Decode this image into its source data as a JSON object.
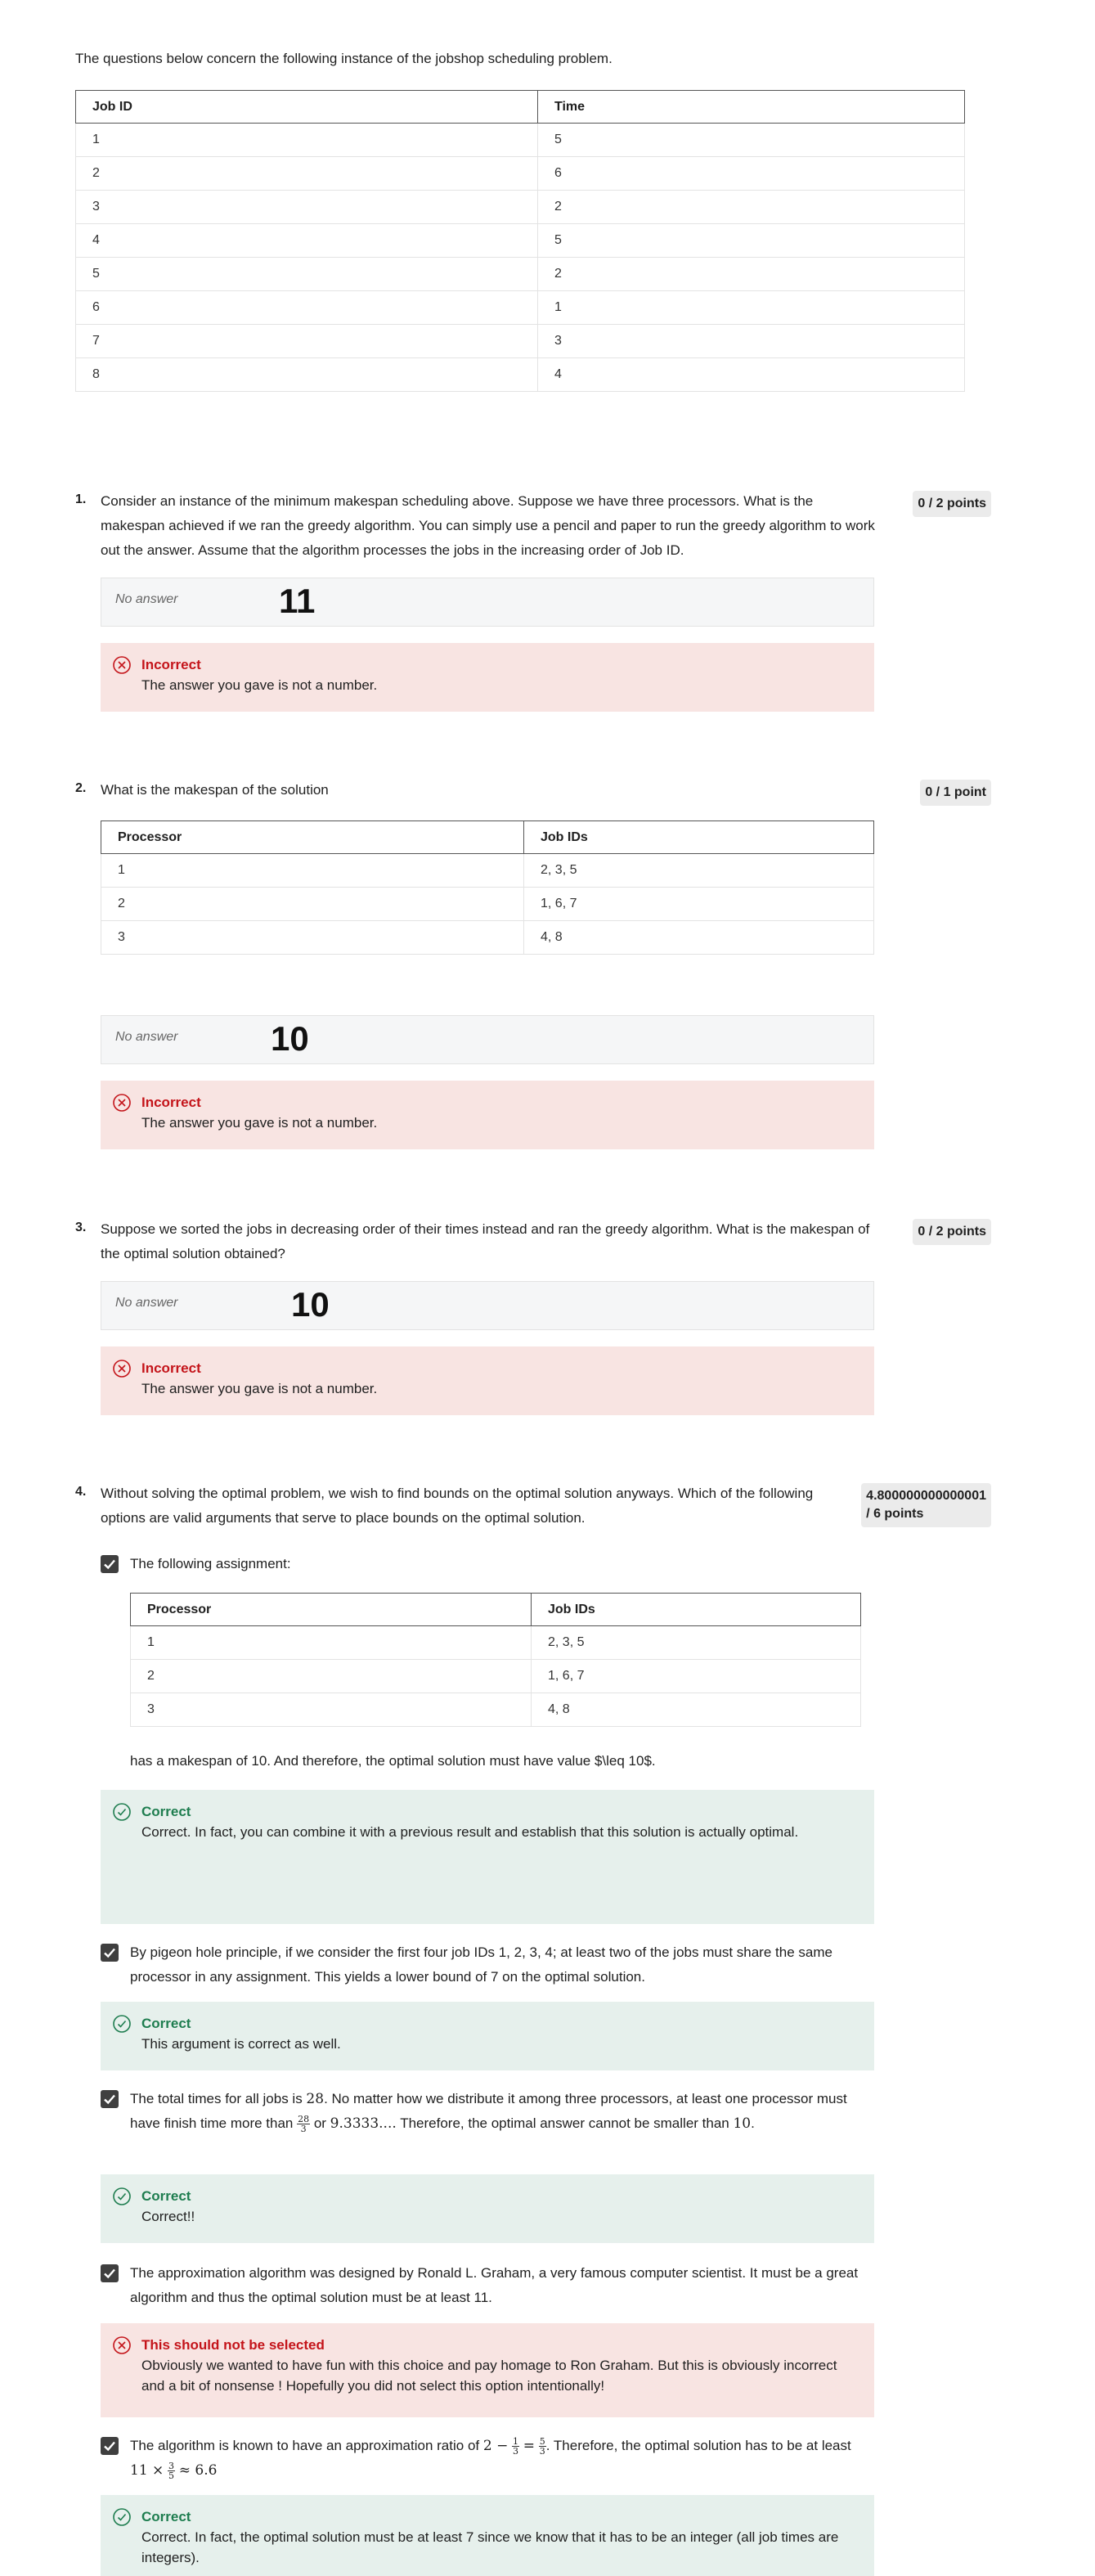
{
  "intro": "The questions below concern the following instance of the jobshop scheduling problem.",
  "jobs_table": {
    "headers": [
      "Job ID",
      "Time"
    ],
    "rows": [
      [
        "1",
        "5"
      ],
      [
        "2",
        "6"
      ],
      [
        "3",
        "2"
      ],
      [
        "4",
        "5"
      ],
      [
        "5",
        "2"
      ],
      [
        "6",
        "1"
      ],
      [
        "7",
        "3"
      ],
      [
        "8",
        "4"
      ]
    ]
  },
  "common": {
    "no_answer": "No answer",
    "incorrect_title": "Incorrect",
    "incorrect_msg": "The answer you gave is not a number.",
    "correct_title": "Correct"
  },
  "q1": {
    "num": "1.",
    "text": "Consider an instance of the minimum makespan scheduling above. Suppose we have three processors. What is the makespan achieved if we ran the greedy algorithm. You can simply use a pencil and paper to run the greedy algorithm to work out the answer. Assume that the algorithm processes the jobs in the increasing order of Job ID.",
    "points": "0 / 2 points",
    "handwritten": "11"
  },
  "q2": {
    "num": "2.",
    "text": "What is the makespan of the solution",
    "points": "0 / 1 point",
    "table": {
      "headers": [
        "Processor",
        "Job IDs"
      ],
      "rows": [
        [
          "1",
          "2, 3, 5"
        ],
        [
          "2",
          "1, 6, 7"
        ],
        [
          "3",
          "4, 8"
        ]
      ]
    },
    "handwritten": "10"
  },
  "q3": {
    "num": "3.",
    "text": "Suppose we sorted the jobs in decreasing order of their times instead and ran the greedy algorithm. What is the makespan of the optimal solution obtained?",
    "points": "0 / 2 points",
    "handwritten": "10"
  },
  "q4": {
    "num": "4.",
    "text": "Without solving the optimal problem, we wish to find bounds on the optimal solution anyways. Which of the following options are valid arguments that serve to place bounds on the  optimal solution.",
    "points_line1": "4.800000000000001",
    "points_line2": "/ 6 points",
    "opt1_label": "The following assignment:",
    "opt1_table": {
      "headers": [
        "Processor",
        "Job IDs"
      ],
      "rows": [
        [
          "1",
          "2, 3, 5"
        ],
        [
          "2",
          "1, 6, 7"
        ],
        [
          "3",
          "4, 8"
        ]
      ]
    },
    "opt1_after": "has a makespan of 10. And therefore, the optimal solution must have value $\\leq 10$.",
    "opt1_fb": "Correct. In fact, you can combine it with a previous result and establish that this solution is actually optimal.",
    "opt2_label": "By pigeon hole principle, if we consider the first four job IDs 1, 2, 3, 4; at least two of the jobs must share the same processor in any assignment. This yields a lower bound of 7 on the optimal solution.",
    "opt2_fb": "This argument is correct as well.",
    "opt3_a": "The total times for all jobs is ",
    "opt3_m1": "28",
    "opt3_b": ". No matter how we distribute it among three processors, at least one processor must have finish time more than ",
    "opt3_fnum": "28",
    "opt3_fden": "3",
    "opt3_c": " or ",
    "opt3_m2": "9.3333....",
    "opt3_d": " Therefore, the optimal answer cannot be smaller than ",
    "opt3_m3": "10",
    "opt3_e": ".",
    "opt3_fb": "Correct!!",
    "opt4_label": "The approximation algorithm was designed by Ronald L. Graham, a very famous computer scientist. It must be a great algorithm and thus the optimal solution must be at least 11.",
    "opt4_fb_title": "This should not be selected",
    "opt4_fb": "Obviously we wanted to have fun with this choice and pay homage to Ron Graham. But this is obviously incorrect and a bit of nonsense ! Hopefully you did not select this option intentionally!",
    "opt5_a": "The algorithm is known to have an approximation ratio of ",
    "opt5_m1": "2 −",
    "opt5_f1num": "1",
    "opt5_f1den": "3",
    "opt5_m2": "=",
    "opt5_f2num": "5",
    "opt5_f2den": "3",
    "opt5_b": ". Therefore, the optimal solution has to be at least ",
    "opt5_m3": "11 ×",
    "opt5_f3num": "3",
    "opt5_f3den": "5",
    "opt5_m4": "≈ 6.6",
    "opt5_fb": "Correct. In fact, the optimal solution must be at least 7 since we know that it has to be an integer (all job times are integers)."
  }
}
